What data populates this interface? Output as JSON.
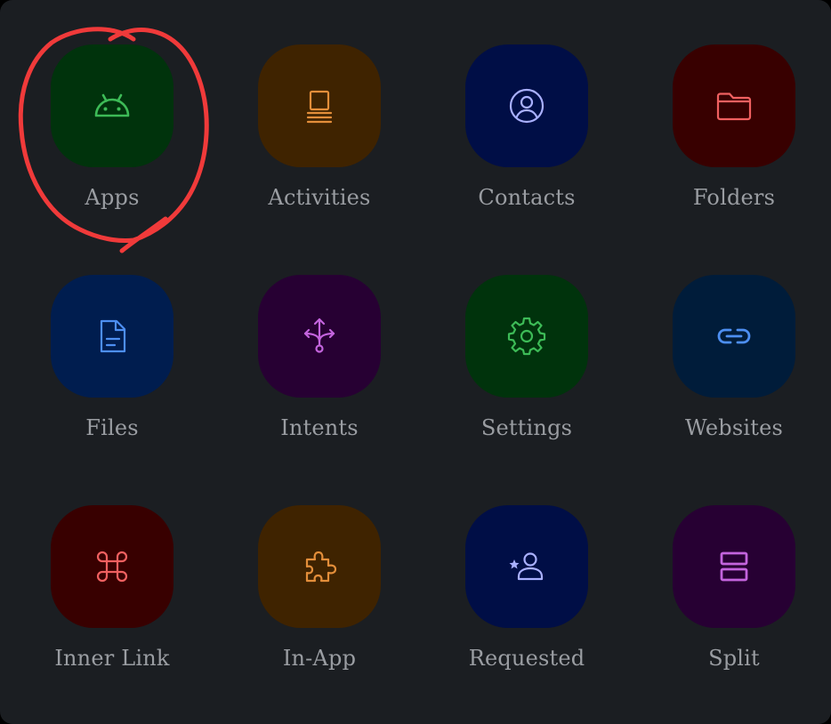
{
  "grid": {
    "items": [
      {
        "label": "Apps",
        "icon": "android-icon",
        "bg": "#00330c",
        "fg": "#3dbb57"
      },
      {
        "label": "Activities",
        "icon": "activities-icon",
        "bg": "#3f2300",
        "fg": "#e38e3a"
      },
      {
        "label": "Contacts",
        "icon": "account-circle-icon",
        "bg": "#000e46",
        "fg": "#a9b0ff"
      },
      {
        "label": "Folders",
        "icon": "folder-icon",
        "bg": "#380000",
        "fg": "#f06060"
      },
      {
        "label": "Files",
        "icon": "file-icon",
        "bg": "#001d4f",
        "fg": "#4d8ff2"
      },
      {
        "label": "Intents",
        "icon": "intents-icon",
        "bg": "#270033",
        "fg": "#c364dd"
      },
      {
        "label": "Settings",
        "icon": "gear-icon",
        "bg": "#00330c",
        "fg": "#3dbb57"
      },
      {
        "label": "Websites",
        "icon": "link-icon",
        "bg": "#001c3a",
        "fg": "#4d8ff2"
      },
      {
        "label": "Inner Link",
        "icon": "command-icon",
        "bg": "#380000",
        "fg": "#f06060"
      },
      {
        "label": "In-App",
        "icon": "puzzle-icon",
        "bg": "#3f2300",
        "fg": "#e38e3a"
      },
      {
        "label": "Requested",
        "icon": "person-star-icon",
        "bg": "#000e46",
        "fg": "#a9b0ff"
      },
      {
        "label": "Split",
        "icon": "split-icon",
        "bg": "#270033",
        "fg": "#c364dd"
      }
    ]
  },
  "annotation": {
    "color": "#f03a3a",
    "target": "Apps"
  }
}
